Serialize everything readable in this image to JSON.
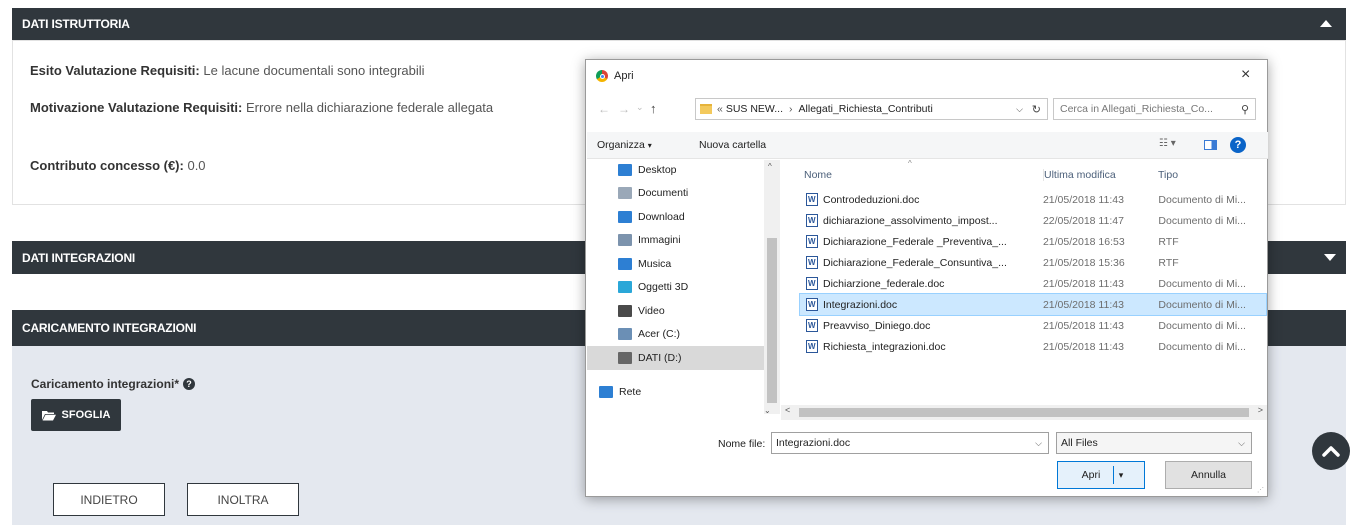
{
  "sections": {
    "istruttoria": {
      "title": "DATI ISTRUTTORIA",
      "fields": [
        {
          "label": "Esito Valutazione Requisiti:",
          "value": "Le lacune documentali sono integrabili"
        },
        {
          "label": "Motivazione Valutazione Requisiti:",
          "value": "Errore nella dichiarazione federale allegata"
        },
        {
          "label": "Contributo concesso (€):",
          "value": "0.0"
        }
      ]
    },
    "integrazioni": {
      "title": "DATI INTEGRAZIONI"
    },
    "caricamento": {
      "title": "CARICAMENTO INTEGRAZIONI",
      "upload_label": "Caricamento integrazioni*",
      "browse_button": "SFOGLIA"
    }
  },
  "buttons": {
    "back": "INDIETRO",
    "forward": "INOLTRA"
  },
  "dialog": {
    "title": "Apri",
    "close": "×",
    "path": {
      "prefix": "«",
      "parts": [
        "SUS NEW...",
        "Allegati_Richiesta_Contributi"
      ],
      "separator": "›"
    },
    "search_placeholder": "Cerca in Allegati_Richiesta_Co...",
    "toolbar": {
      "organize": "Organizza",
      "new_folder": "Nuova cartella"
    },
    "nav": [
      {
        "label": "Desktop",
        "icon": "desktop-icon",
        "color": "#2d7fd3"
      },
      {
        "label": "Documenti",
        "icon": "documents-icon",
        "color": "#9aa8b8"
      },
      {
        "label": "Download",
        "icon": "download-icon",
        "color": "#2d7fd3"
      },
      {
        "label": "Immagini",
        "icon": "pictures-icon",
        "color": "#7c93ad"
      },
      {
        "label": "Musica",
        "icon": "music-icon",
        "color": "#2d7fd3"
      },
      {
        "label": "Oggetti 3D",
        "icon": "objects3d-icon",
        "color": "#2aa7d8"
      },
      {
        "label": "Video",
        "icon": "video-icon",
        "color": "#4a4a4a"
      },
      {
        "label": "Acer (C:)",
        "icon": "drive-icon",
        "color": "#6b8fb5"
      },
      {
        "label": "DATI (D:)",
        "icon": "drive-icon",
        "color": "#666666"
      },
      {
        "label": "Rete",
        "icon": "network-icon",
        "color": "#2d7fd3"
      }
    ],
    "columns": {
      "name": "Nome",
      "modified": "Ultima modifica",
      "type": "Tipo"
    },
    "files": [
      {
        "name": "Controdeduzioni.doc",
        "date": "21/05/2018 11:43",
        "type": "Documento di Mi..."
      },
      {
        "name": "dichiarazione_assolvimento_impost...",
        "date": "22/05/2018 11:47",
        "type": "Documento di Mi..."
      },
      {
        "name": "Dichiarazione_Federale _Preventiva_...",
        "date": "21/05/2018 16:53",
        "type": "RTF"
      },
      {
        "name": "Dichiarazione_Federale_Consuntiva_...",
        "date": "21/05/2018 15:36",
        "type": "RTF"
      },
      {
        "name": "Dichiarzione_federale.doc",
        "date": "21/05/2018 11:43",
        "type": "Documento di Mi..."
      },
      {
        "name": "Integrazioni.doc",
        "date": "21/05/2018 11:43",
        "type": "Documento di Mi..."
      },
      {
        "name": "Preavviso_Diniego.doc",
        "date": "21/05/2018 11:43",
        "type": "Documento di Mi..."
      },
      {
        "name": "Richiesta_integrazioni.doc",
        "date": "21/05/2018 11:43",
        "type": "Documento di Mi..."
      }
    ],
    "selected_file": "Integrazioni.doc",
    "filename_label": "Nome file:",
    "filename_value": "Integrazioni.doc",
    "filter": "All Files",
    "open_button": "Apri",
    "cancel_button": "Annulla"
  },
  "colors": {
    "dark": "#30373d",
    "selection": "#cce8ff",
    "help": "#0a64c8"
  }
}
